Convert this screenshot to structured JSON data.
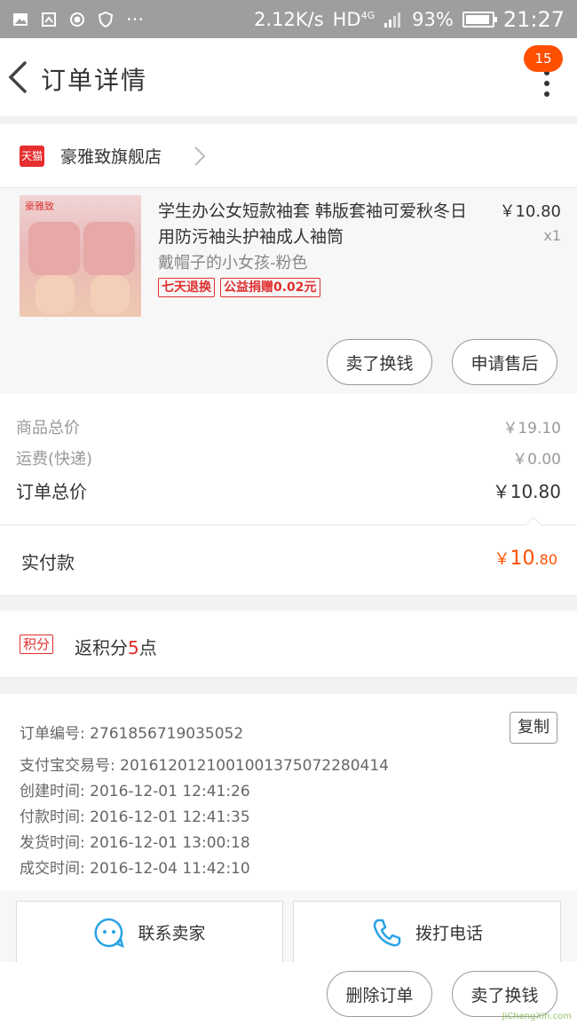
{
  "status_bar": {
    "net_speed": "2.12K/s",
    "network": "HD",
    "network_gen": "4G",
    "battery": "93%",
    "battery_level": 0.93,
    "time": "21:27"
  },
  "nav": {
    "title": "订单详情",
    "badge_count": "15"
  },
  "shop": {
    "platform_badge": "天猫",
    "name": "豪雅致旗舰店"
  },
  "item": {
    "thumb_brand": "豪雅致",
    "title": "学生办公女短款袖套 韩版套袖可爱秋冬日用防污袖头护袖成人袖筒",
    "sku": "戴帽子的小女孩-粉色",
    "tags": [
      "七天退换",
      "公益捐赠0.02元"
    ],
    "price": "￥10.80",
    "qty": "x1",
    "sell_button": "卖了换钱",
    "aftersale_button": "申请售后"
  },
  "prices": {
    "goods_total_label": "商品总价",
    "goods_total": "￥19.10",
    "shipping_label": "运费(快递)",
    "shipping": "￥0.00",
    "order_total_label": "订单总价",
    "order_total": "￥10.80",
    "paid_label": "实付款",
    "paid_yen": "￥",
    "paid_int": "10",
    "paid_dec": ".80"
  },
  "points": {
    "badge": "积分",
    "prefix": "返积分",
    "count": "5",
    "suffix": "点"
  },
  "order_info": {
    "order_no": "订单编号: 2761856719035052",
    "alipay_no": "支付宝交易号: 2016120121001001375072280414",
    "created": "创建时间: 2016-12-01 12:41:26",
    "paid": "付款时间: 2016-12-01 12:41:35",
    "shipped": "发货时间: 2016-12-01 13:00:18",
    "completed": "成交时间: 2016-12-04 11:42:10",
    "copy_button": "复制"
  },
  "contact": {
    "seller": "联系卖家",
    "phone": "拨打电话"
  },
  "bottom": {
    "delete_button": "删除订单",
    "sell_button": "卖了换钱"
  },
  "watermark": "JiChengXin.com",
  "colors": {
    "accent": "#ff5000",
    "tag_red": "#e03030",
    "status_bar": "#9e9e9e"
  }
}
